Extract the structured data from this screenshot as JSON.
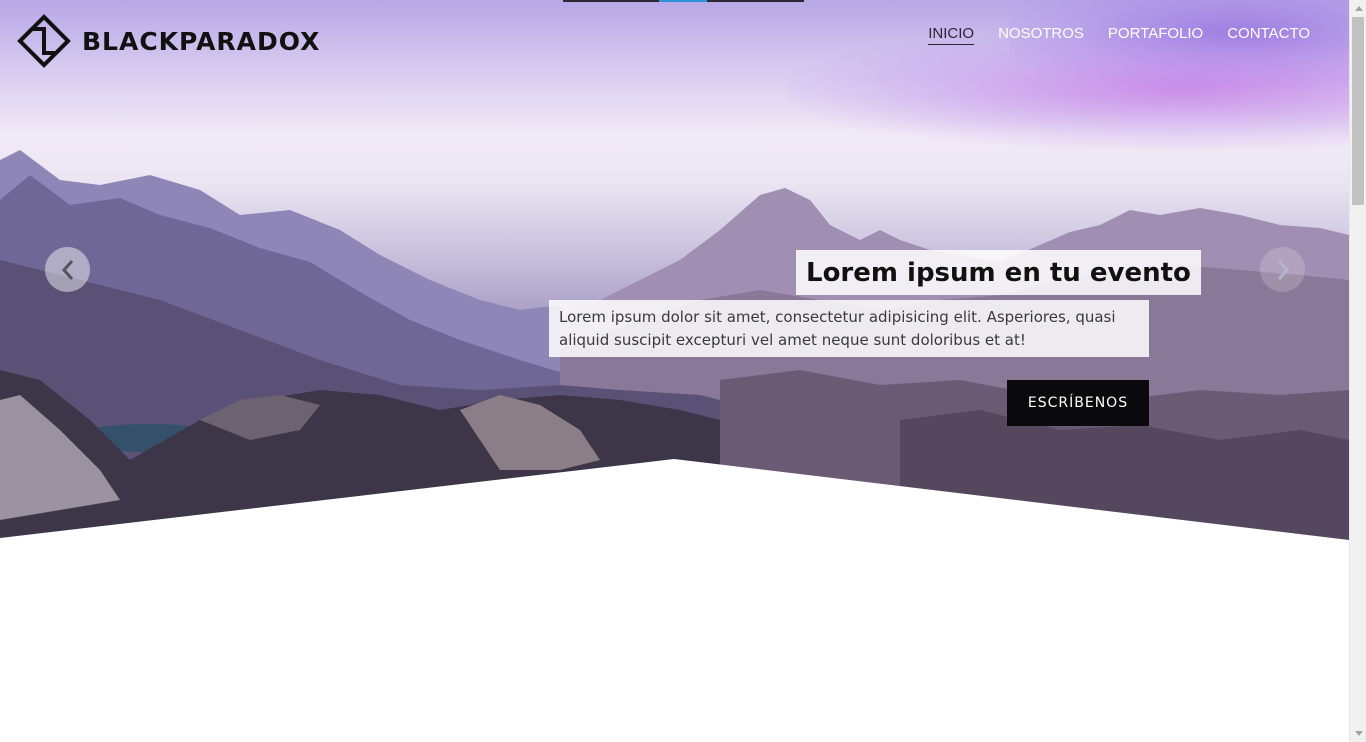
{
  "brand": {
    "name": "BLACKPARADOX",
    "logo_icon": "diamond-arrows-logo"
  },
  "nav": {
    "items": [
      {
        "label": "INICIO",
        "active": true
      },
      {
        "label": "NOSOTROS",
        "active": false
      },
      {
        "label": "PORTAFOLIO",
        "active": false
      },
      {
        "label": "CONTACTO",
        "active": false
      }
    ]
  },
  "carousel": {
    "indicators": 3,
    "active_index": 1,
    "prev_icon": "chevron-left-icon",
    "next_icon": "chevron-right-icon",
    "slide": {
      "title": "Lorem ipsum en tu evento",
      "text": "Lorem ipsum dolor sit amet, consectetur adipisicing elit. Asperiores, quasi aliquid suscipit excepturi vel amet neque sunt doloribus et at!",
      "cta_label": "ESCRÍBENOS"
    }
  },
  "colors": {
    "accent": "#2f8fd8",
    "cta_bg": "#0a0a0c",
    "text_dark": "#111111"
  }
}
